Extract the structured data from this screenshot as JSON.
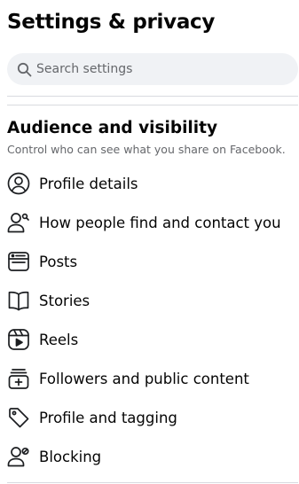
{
  "page": {
    "title": "Settings & privacy"
  },
  "search": {
    "placeholder": "Search settings",
    "value": "",
    "icon": "search-icon"
  },
  "section": {
    "title": "Audience and visibility",
    "subtitle": "Control who can see what you share on Facebook."
  },
  "menu": {
    "items": [
      {
        "label": "Profile details",
        "icon": "user-circle-icon"
      },
      {
        "label": "How people find and contact you",
        "icon": "user-search-icon"
      },
      {
        "label": "Posts",
        "icon": "post-card-icon"
      },
      {
        "label": "Stories",
        "icon": "book-open-icon"
      },
      {
        "label": "Reels",
        "icon": "reels-play-icon"
      },
      {
        "label": "Followers and public content",
        "icon": "follower-add-icon"
      },
      {
        "label": "Profile and tagging",
        "icon": "tag-icon"
      },
      {
        "label": "Blocking",
        "icon": "user-blocked-icon"
      }
    ]
  },
  "colors": {
    "text": "#050505",
    "secondary": "#65676b",
    "search_bg": "#f0f2f5",
    "divider": "#d8dadf"
  }
}
